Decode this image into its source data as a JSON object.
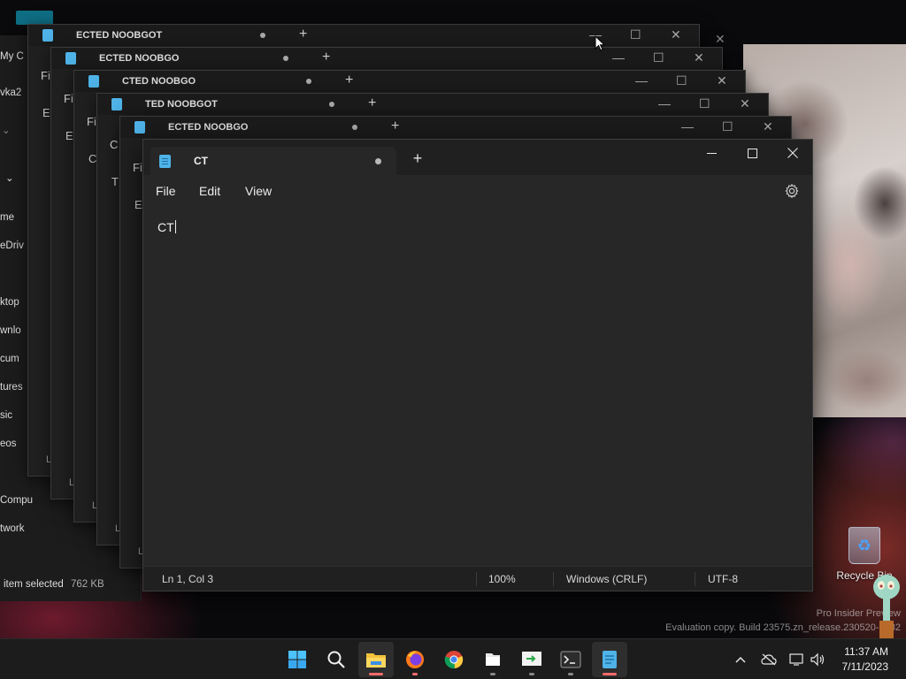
{
  "desktop": {
    "recycle_bin_label": "Recycle Bin",
    "watermark_line1": "Pro Insider Preview",
    "watermark_line2": "Evaluation copy. Build 23575.zn_release.230520-1332"
  },
  "explorer_behind": {
    "items": [
      "My C",
      "vka2",
      "me",
      "eDriv",
      "ktop",
      "wnlo",
      "cum",
      "tures",
      "sic",
      "eos",
      "Compu",
      "twork"
    ],
    "status_selected": "item selected",
    "status_size": "762 KB"
  },
  "background_windows": [
    {
      "title": "ECTED NOOBGOT",
      "menu_letter": "Fil",
      "footer": "L"
    },
    {
      "title": "ECTED NOOBGO",
      "menu_letter": "Fil",
      "footer": "L"
    },
    {
      "title": "CTED NOOBGO",
      "menu_letter": "Fi",
      "footer": "L"
    },
    {
      "title": "TED NOOBGOT",
      "menu_letter": "C",
      "footer": "L"
    },
    {
      "title": "ECTED NOOBGO",
      "menu_letter": "Fi",
      "footer": "L"
    }
  ],
  "notepad": {
    "tab_title": "CT",
    "new_tab_symbol": "+",
    "menu": [
      "File",
      "Edit",
      "View"
    ],
    "content": "CT",
    "status": {
      "position": "Ln 1, Col 3",
      "zoom": "100%",
      "line_ending": "Windows (CRLF)",
      "encoding": "UTF-8"
    }
  },
  "taskbar": {
    "apps": [
      "start-icon",
      "search-icon",
      "file-explorer-icon",
      "firefox-icon",
      "chrome-icon",
      "files-icon",
      "remote-desktop-icon",
      "terminal-icon",
      "notepad-icon"
    ],
    "clock_time": "11:37 AM",
    "clock_date": "7/11/2023"
  },
  "colors": {
    "accent": "#4fb3e8",
    "active_indicator": "#ff6b6b",
    "window_bg": "#272727"
  }
}
